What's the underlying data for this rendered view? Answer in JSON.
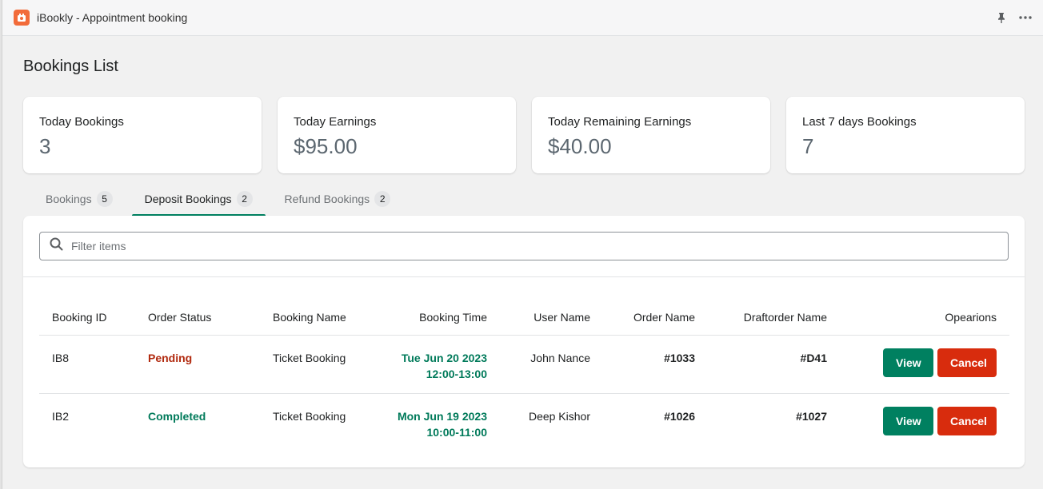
{
  "app": {
    "title": "iBookly - Appointment booking",
    "accent": "#008060",
    "logo_color": "#f26b3a"
  },
  "titlebar": {
    "icons": [
      "pin-icon",
      "more-icon"
    ]
  },
  "page": {
    "title": "Bookings List"
  },
  "stats": [
    {
      "label": "Today Bookings",
      "value": "3"
    },
    {
      "label": "Today Earnings",
      "value": "$95.00"
    },
    {
      "label": "Today Remaining Earnings",
      "value": "$40.00"
    },
    {
      "label": "Last 7 days Bookings",
      "value": "7"
    }
  ],
  "tabs": [
    {
      "label": "Bookings",
      "count": "5",
      "active": false
    },
    {
      "label": "Deposit Bookings",
      "count": "2",
      "active": true
    },
    {
      "label": "Refund Bookings",
      "count": "2",
      "active": false
    }
  ],
  "filter": {
    "placeholder": "Filter items",
    "value": ""
  },
  "table": {
    "headers": [
      "Booking ID",
      "Order Status",
      "Booking Name",
      "Booking Time",
      "User Name",
      "Order Name",
      "Draftorder Name",
      "Opearions"
    ],
    "rows": [
      {
        "booking_id": "IB8",
        "status": "Pending",
        "booking_name": "Ticket Booking",
        "time_date": "Tue Jun 20 2023",
        "time_range": "12:00-13:00",
        "user_name": "John Nance",
        "order_name": "#1033",
        "draftorder_name": "#D41"
      },
      {
        "booking_id": "IB2",
        "status": "Completed",
        "booking_name": "Ticket Booking",
        "time_date": "Mon Jun 19 2023",
        "time_range": "10:00-11:00",
        "user_name": "Deep Kishor",
        "order_name": "#1026",
        "draftorder_name": "#1027"
      }
    ],
    "actions": {
      "view": "View",
      "cancel": "Cancel"
    },
    "status_colors": {
      "Pending": "#b1290e",
      "Completed": "#007a5a"
    }
  }
}
